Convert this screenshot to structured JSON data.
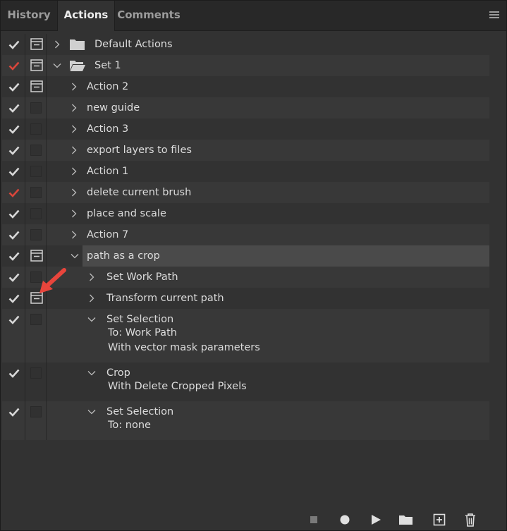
{
  "tabs": [
    {
      "label": "History",
      "active": false
    },
    {
      "label": "Actions",
      "active": true
    },
    {
      "label": "Comments",
      "active": false
    }
  ],
  "colors": {
    "check": "#d8d8d8",
    "check_partial": "#d9463b",
    "annotation_arrow": "#e8453c"
  },
  "icons": {
    "panel_menu": "hamburger-menu-icon",
    "expanded": "chevron-down-icon",
    "collapsed": "chevron-right-icon",
    "dialog_on": "dialog-toggle-icon",
    "folder": "folder-icon"
  },
  "actions": {
    "sets": [
      {
        "label": "Default Actions",
        "check": "full",
        "dialog": true,
        "expanded": false
      },
      {
        "label": "Set 1",
        "check": "partial",
        "dialog": true,
        "expanded": true
      }
    ],
    "set1_actions": [
      {
        "label": "Action 2",
        "check": "full",
        "dialog": true
      },
      {
        "label": "new guide",
        "check": "full",
        "dialog": false
      },
      {
        "label": "Action 3",
        "check": "full",
        "dialog": false
      },
      {
        "label": "export layers to files",
        "check": "full",
        "dialog": false
      },
      {
        "label": "Action 1",
        "check": "full",
        "dialog": false
      },
      {
        "label": "delete current brush",
        "check": "partial",
        "dialog": false
      },
      {
        "label": "place and scale",
        "check": "full",
        "dialog": false
      },
      {
        "label": "Action 7",
        "check": "full",
        "dialog": false
      },
      {
        "label": "path as a crop",
        "check": "full",
        "dialog": true,
        "selected": true
      }
    ],
    "steps": [
      {
        "label": "Set Work Path",
        "expanded": false,
        "dialog": false,
        "details": []
      },
      {
        "label": "Transform current path",
        "expanded": false,
        "dialog": true,
        "details": []
      },
      {
        "label": "Set Selection",
        "expanded": true,
        "dialog": false,
        "details": [
          "To: Work Path",
          "With vector mask parameters"
        ]
      },
      {
        "label": "Crop",
        "expanded": true,
        "dialog": false,
        "details": [
          "With Delete Cropped Pixels"
        ]
      },
      {
        "label": "Set Selection",
        "expanded": true,
        "dialog": false,
        "details": [
          "To: none"
        ]
      }
    ]
  },
  "toolbar": [
    {
      "name": "stop-button",
      "icon": "stop-icon"
    },
    {
      "name": "record-button",
      "icon": "record-icon"
    },
    {
      "name": "play-button",
      "icon": "play-icon"
    },
    {
      "name": "new-set-button",
      "icon": "folder-icon"
    },
    {
      "name": "new-action-button",
      "icon": "add-square-icon"
    },
    {
      "name": "delete-button",
      "icon": "trash-icon"
    }
  ]
}
